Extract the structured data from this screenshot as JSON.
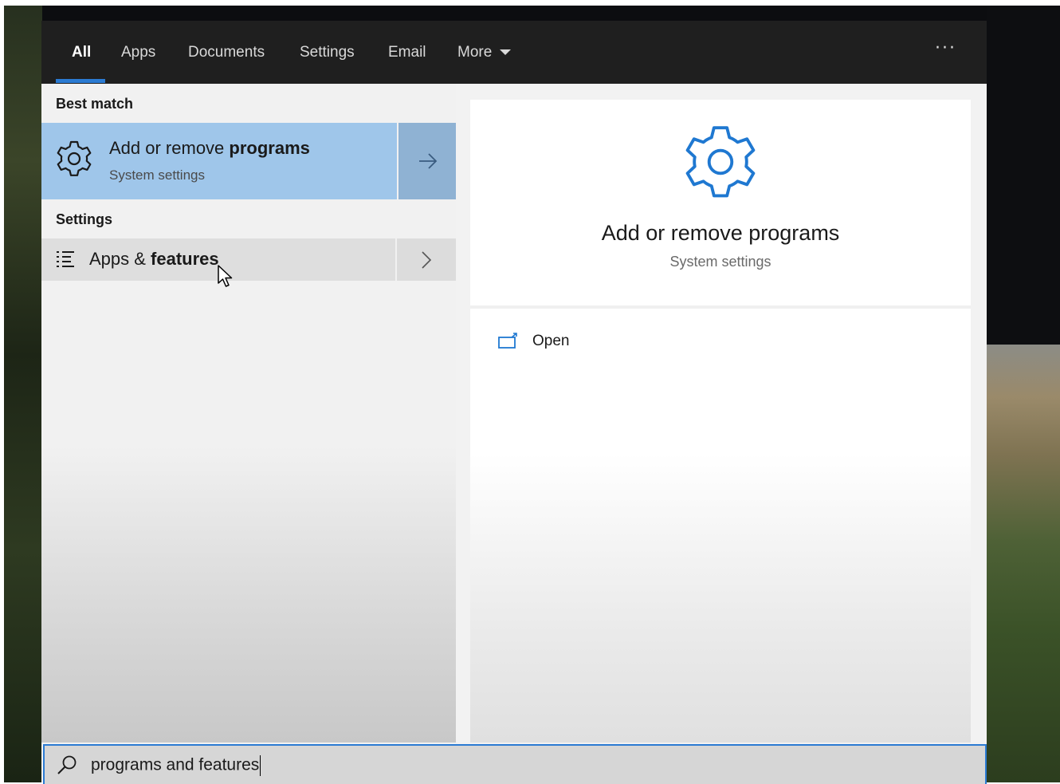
{
  "tabs": [
    {
      "label": "All",
      "active": true
    },
    {
      "label": "Apps",
      "active": false
    },
    {
      "label": "Documents",
      "active": false
    },
    {
      "label": "Settings",
      "active": false
    },
    {
      "label": "Email",
      "active": false
    },
    {
      "label": "More",
      "active": false
    }
  ],
  "tabbar": {
    "more_options": "···"
  },
  "left": {
    "best_match_label": "Best match",
    "best_match": {
      "title_prefix": "Add or remove ",
      "title_bold": "programs",
      "subtitle": "System settings",
      "icon": "gear-icon"
    },
    "settings_label": "Settings",
    "settings_items": [
      {
        "prefix": "Apps & ",
        "bold": "features",
        "icon": "list-icon"
      }
    ]
  },
  "preview": {
    "title": "Add or remove programs",
    "subtitle": "System settings",
    "icon": "gear-icon",
    "actions": [
      {
        "label": "Open",
        "icon": "open-window-icon"
      }
    ]
  },
  "search": {
    "value": "programs and features",
    "icon": "search-icon"
  },
  "colors": {
    "accent": "#2b7bd3",
    "selected_bg": "#9fc6ea",
    "tabbar_bg": "#1f1f1f"
  }
}
